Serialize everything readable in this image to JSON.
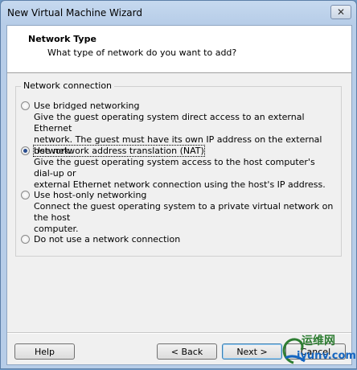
{
  "window": {
    "title": "New Virtual Machine Wizard",
    "close_glyph": "✕"
  },
  "header": {
    "title": "Network Type",
    "subtitle": "What type of network do you want to add?"
  },
  "group": {
    "label": "Network connection",
    "options": [
      {
        "label": "Use bridged networking",
        "checked": false,
        "desc_lines": [
          "Give the guest operating system direct access to an external Ethernet",
          "network. The guest must have its own IP address on the external network."
        ]
      },
      {
        "label": "Use network address translation (NAT)",
        "checked": true,
        "desc_lines": [
          "Give the guest operating system access to the host computer's dial-up or",
          "external Ethernet network connection using the host's IP address."
        ]
      },
      {
        "label": "Use host-only networking",
        "checked": false,
        "desc_lines": [
          "Connect the guest operating system to a private virtual network on the host",
          "computer."
        ]
      },
      {
        "label": "Do not use a network connection",
        "checked": false,
        "desc_lines": []
      }
    ]
  },
  "buttons": {
    "help": "Help",
    "back": "< Back",
    "next": "Next >",
    "cancel": "Cancel"
  },
  "watermark": {
    "cn": "运维网",
    "en": "iyunv.com"
  },
  "colors": {
    "accent": "#3c7fb1",
    "title_gradient": "#b7cde8"
  }
}
